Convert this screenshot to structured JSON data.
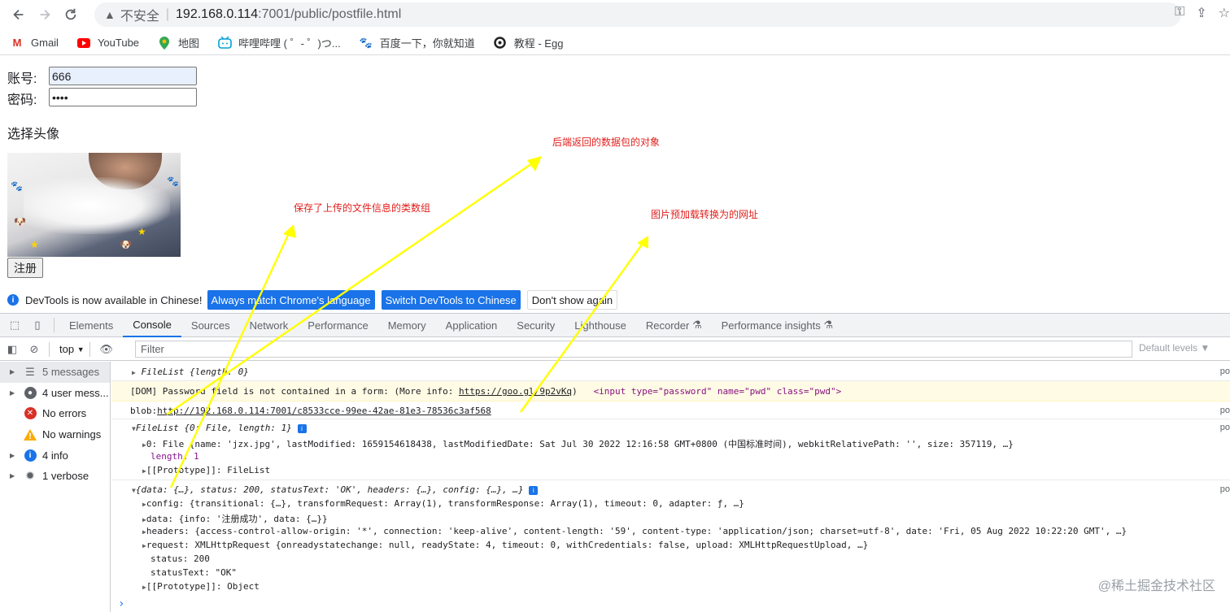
{
  "browser": {
    "security_label": "不安全",
    "url_host": "192.168.0.114",
    "url_path": ":7001/public/postfile.html"
  },
  "bookmarks": [
    {
      "label": "Gmail"
    },
    {
      "label": "YouTube"
    },
    {
      "label": "地图"
    },
    {
      "label": "哔哩哔哩 ( ゜- ゜)つ..."
    },
    {
      "label": "百度一下，你就知道"
    },
    {
      "label": "教程 - Egg"
    }
  ],
  "form": {
    "account_label": "账号:",
    "account_value": "666",
    "password_label": "密码:",
    "password_value": "••••",
    "avatar_label": "选择头像",
    "register_label": "注册"
  },
  "annotations": {
    "filelist_note": "保存了上传的文件信息的类数组",
    "response_note": "后端返回的数据包的对象",
    "blob_note": "图片预加载转换为的网址"
  },
  "devtools_banner": {
    "message": "DevTools is now available in Chinese!",
    "btn_match": "Always match Chrome's language",
    "btn_switch": "Switch DevTools to Chinese",
    "btn_dismiss": "Don't show again"
  },
  "devtools_tabs": [
    "Elements",
    "Console",
    "Sources",
    "Network",
    "Performance",
    "Memory",
    "Application",
    "Security",
    "Lighthouse",
    "Recorder",
    "Performance insights"
  ],
  "console_bar": {
    "context": "top",
    "filter_placeholder": "Filter",
    "levels": "Default levels"
  },
  "sidebar": [
    {
      "label": "5 messages",
      "icon": "list-icon"
    },
    {
      "label": "4 user mess...",
      "icon": "user-icon"
    },
    {
      "label": "No errors",
      "icon": "error-icon"
    },
    {
      "label": "No warnings",
      "icon": "warning-icon"
    },
    {
      "label": "4 info",
      "icon": "info-icon"
    },
    {
      "label": "1 verbose",
      "icon": "bug-icon"
    }
  ],
  "console": {
    "source": "po",
    "m1": "FileList {length: 0}",
    "m2_prefix": "[DOM] Password field is not contained in a form: (More info: ",
    "m2_link": "https://goo.gl/9p2vKq",
    "m2_suffix": ")",
    "m2_tag": "<input type=\"password\" name=\"pwd\" class=\"pwd\">",
    "m3_prefix": "blob:",
    "m3_link": "http://192.168.0.114:7001/c8533cce-99ee-42ae-81e3-78536c3af568",
    "m4_head": "FileList {0: File, length: 1}",
    "m4_l1": "0: File {name: 'jzx.jpg', lastModified: 1659154618438, lastModifiedDate: Sat Jul 30 2022 12:16:58 GMT+0800 (中国标准时间), webkitRelativePath: '', size: 357119, …}",
    "m4_l2": "length: 1",
    "m4_l3": "[[Prototype]]: FileList",
    "m5_head": "{data: {…}, status: 200, statusText: 'OK', headers: {…}, config: {…}, …}",
    "m5_l1": "config: {transitional: {…}, transformRequest: Array(1), transformResponse: Array(1), timeout: 0, adapter: ƒ, …}",
    "m5_l2": "data: {info: '注册成功', data: {…}}",
    "m5_l3": "headers: {access-control-allow-origin: '*', connection: 'keep-alive', content-length: '59', content-type: 'application/json; charset=utf-8', date: 'Fri, 05 Aug 2022 10:22:20 GMT', …}",
    "m5_l4": "request: XMLHttpRequest {onreadystatechange: null, readyState: 4, timeout: 0, withCredentials: false, upload: XMLHttpRequestUpload, …}",
    "m5_l5": "status: 200",
    "m5_l6": "statusText: \"OK\"",
    "m5_l7": "[[Prototype]]: Object",
    "prompt": "›"
  },
  "watermark": "@稀土掘金技术社区",
  "colors": {
    "accent": "#1a73e8",
    "annotation": "#e0201d",
    "arrow": "#ffff00",
    "warning_bg": "#fffbe5"
  }
}
